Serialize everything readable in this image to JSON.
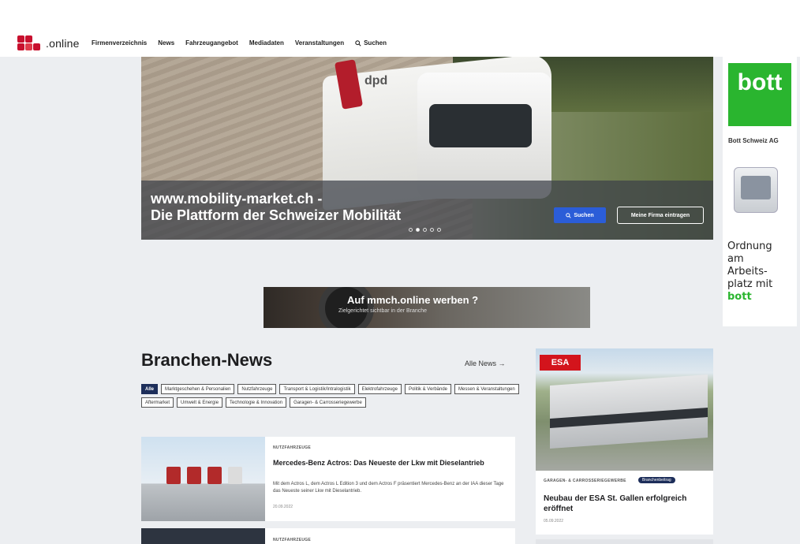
{
  "logo": {
    "text": ".online"
  },
  "nav": {
    "items": [
      "Firmenverzeichnis",
      "News",
      "Fahrzeugangebot",
      "Mediadaten",
      "Veranstaltungen"
    ],
    "search_label": "Suchen"
  },
  "hero": {
    "title_line1": "www.mobility-market.ch -",
    "title_line2": "Die Plattform der Schweizer Mobilität",
    "search_button": "Suchen",
    "add_company_button": "Meine Firma eintragen",
    "truck_brand": "dpd",
    "slides": 5,
    "active_slide": 2
  },
  "ad_right": {
    "logo": "bott",
    "company": "Bott Schweiz AG",
    "slogan_lines": [
      "Ordnung",
      "am",
      "Arbeits-",
      "platz mit"
    ],
    "slogan_brand": "bott"
  },
  "banner": {
    "title": "Auf mmch.online werben ?",
    "subtitle": "Zielgerichtet sichtbar in der Branche"
  },
  "news": {
    "heading": "Branchen-News",
    "all_news": "Alle News →",
    "tags": [
      "Alle",
      "Marktgeschehen & Personalien",
      "Nutzfahrzeuge",
      "Transport & Logistik/Intralogistik",
      "Elektrofahrzeuge",
      "Politik & Verbände",
      "Messen & Veranstaltungen",
      "Aftermarket",
      "Umwelt & Energie",
      "Technologie & Innovation",
      "Garagen- & Carrosseriegewerbe"
    ],
    "articles": [
      {
        "category": "NUTZFAHRZEUGE",
        "title": "Mercedes-Benz Actros: Das Neueste der Lkw mit Dieselantrieb",
        "teaser": "Mit dem Actros L, dem Actros L Edition 3 und dem Actros F präsentiert Mercedes-Benz an der IAA dieser Tage das Neueste seiner Lkw mit Dieselantrieb.",
        "date": "20.09.2022"
      },
      {
        "category": "NUTZFAHRZEUGE"
      }
    ],
    "featured": {
      "logo": "ESA",
      "category": "GARAGEN- & CARROSSERIEGEWERBE",
      "badge": "Branchenbeitrag",
      "title": "Neubau der ESA St. Gallen erfolgreich eröffnet",
      "date": "05.09.2022"
    }
  },
  "colors": {
    "accent_blue": "#2b5dd8",
    "brand_red": "#d3141c",
    "bott_green": "#2ab52f",
    "navy": "#1d2e5a"
  }
}
